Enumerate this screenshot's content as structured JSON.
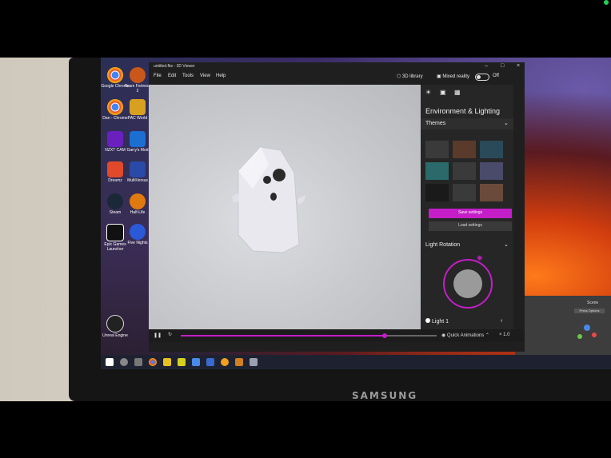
{
  "viewer": {
    "title": "untitled.fbx - 3D Viewer",
    "menu": [
      "File",
      "Edit",
      "Tools",
      "View",
      "Help"
    ],
    "library_label": "3D library",
    "mixed_reality_label": "Mixed reality",
    "mixed_reality_state": "Off",
    "panel_title": "Environment & Lighting",
    "themes_label": "Themes",
    "save_settings": "Save settings",
    "load_settings": "Load settings",
    "light_rotation_label": "Light Rotation",
    "light_1_label": "Light 1",
    "quick_animations_label": "Quick Animations",
    "speed_label": "× 1.0",
    "accent": "#c41ec8"
  },
  "desktop_icons": [
    {
      "label": "Google Chrome",
      "icon": "chrome-icon"
    },
    {
      "label": "Team Fortress 2",
      "icon": "tf2-icon"
    },
    {
      "label": "Dan - Chrome",
      "icon": "chrome-icon"
    },
    {
      "label": "PAC World",
      "icon": "pac-icon"
    },
    {
      "label": "NZXT CAM",
      "icon": "nzxt-icon"
    },
    {
      "label": "Garry's Mod",
      "icon": "gmod-icon"
    },
    {
      "label": "Dreamz",
      "icon": "app-icon"
    },
    {
      "label": "MultiVersus",
      "icon": "app-icon"
    },
    {
      "label": "Steam",
      "icon": "steam-icon"
    },
    {
      "label": "Half-Life",
      "icon": "halflife-icon"
    },
    {
      "label": "Epic Games Launcher",
      "icon": "epic-icon"
    },
    {
      "label": "Five Nights",
      "icon": "app-icon"
    },
    {
      "label": "Unreal Engine",
      "icon": "unreal-icon"
    }
  ],
  "monitor_brand": "SAMSUNG",
  "blender": {
    "scene_label": "Scene",
    "press_options": "Press Options"
  }
}
